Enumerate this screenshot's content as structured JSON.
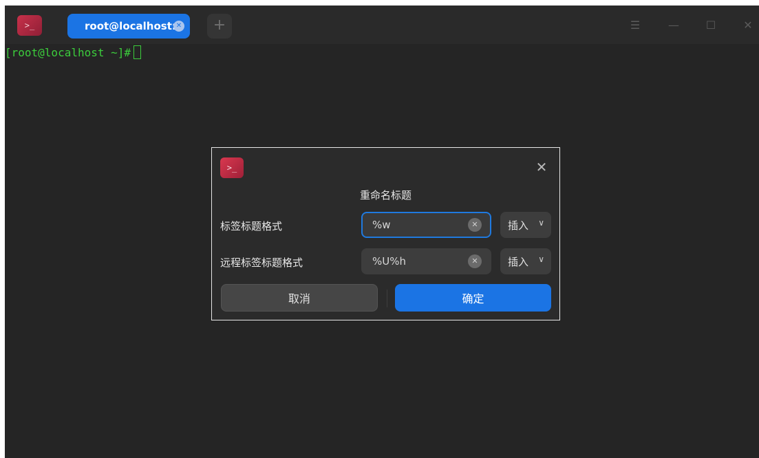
{
  "app": {
    "icon": "terminal-icon",
    "brand_color": "#c8314a",
    "accent_color": "#1b74e4"
  },
  "tabs": [
    {
      "label": "root@localhost:~",
      "active": true
    }
  ],
  "new_tab_label": "+",
  "window_controls": {
    "menu": "☰",
    "minimize": "—",
    "maximize": "☐",
    "close": "✕"
  },
  "terminal": {
    "prompt": "[root@localhost ~]#",
    "text_color": "#3ccd3c"
  },
  "dialog": {
    "title": "重命名标题",
    "close_glyph": "✕",
    "rows": [
      {
        "label": "标签标题格式",
        "value": "%w",
        "insert_label": "插入",
        "focused": true
      },
      {
        "label": "远程标签标题格式",
        "value": "%U%h",
        "insert_label": "插入",
        "focused": false
      }
    ],
    "cancel_label": "取消",
    "confirm_label": "确定"
  }
}
